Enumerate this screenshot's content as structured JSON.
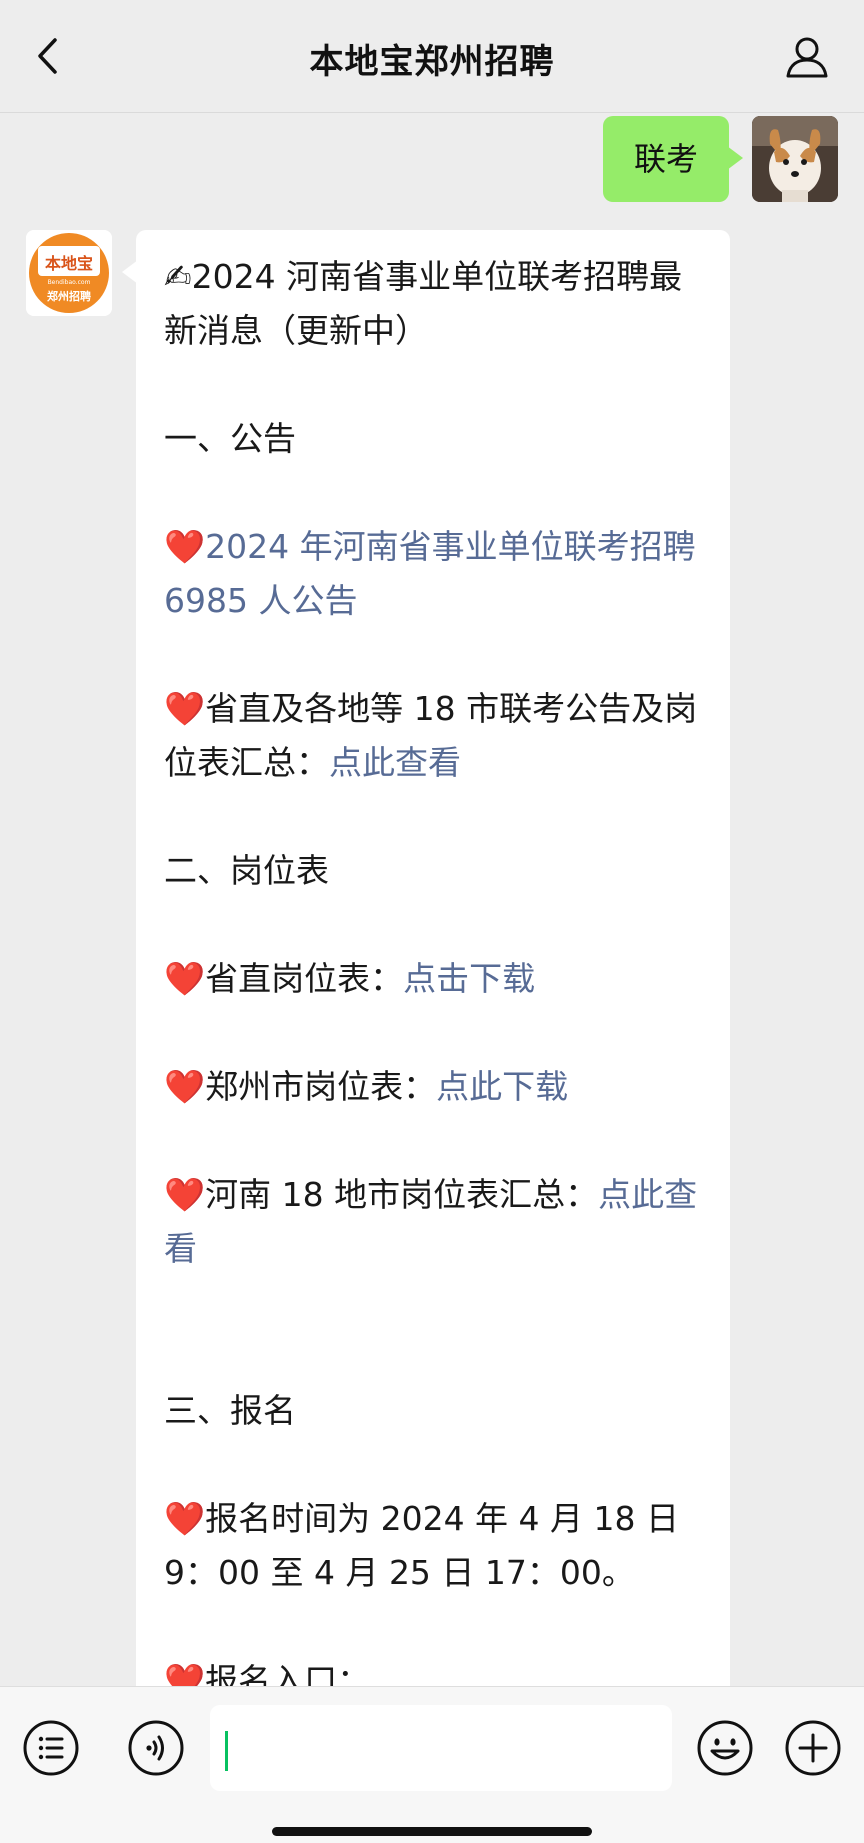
{
  "header": {
    "title": "本地宝郑州招聘",
    "back_icon": "chevron-left-icon",
    "profile_icon": "person-icon"
  },
  "messages": {
    "sent": {
      "text": "联考"
    },
    "received_avatar": {
      "logo_top": "本地宝",
      "logo_site": "Bendibao.com",
      "logo_bottom": "郑州招聘",
      "brand_color": "#f08a24"
    },
    "received": {
      "title_emoji": "✍",
      "title": "2024 河南省事业单位联考招聘最新消息（更新中）",
      "section1": "一、公告",
      "item1_link": "2024 年河南省事业单位联考招聘 6985 人公告",
      "item2_text": "省直及各地等 18 市联考公告及岗位表汇总：",
      "item2_link": "点此查看",
      "section2": "二、岗位表",
      "item3_text": "省直岗位表：",
      "item3_link": "点击下载",
      "item4_text": "郑州市岗位表：",
      "item4_link": "点此下载",
      "item5_text": "河南 18 地市岗位表汇总：",
      "item5_link": "点此查看",
      "section3": "三、报名",
      "item6_text": "报名时间为 2024 年 4 月 18 日 9：00 至 4 月 25 日 17：00。",
      "item7_text": "报名入口："
    },
    "heart": "❤️"
  },
  "bottombar": {
    "menu_icon": "list-menu-icon",
    "voice_icon": "voice-icon",
    "emoji_icon": "emoji-icon",
    "plus_icon": "plus-icon"
  },
  "colors": {
    "link": "#576b95",
    "sent_bubble": "#95ec69",
    "caret": "#07c160"
  }
}
